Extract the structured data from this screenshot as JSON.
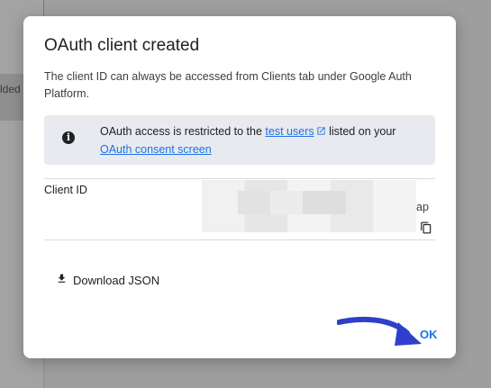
{
  "background": {
    "partial_label": "lded"
  },
  "dialog": {
    "title": "OAuth client created",
    "description": "The client ID can always be accessed from Clients tab under Google Auth Platform.",
    "notice": {
      "prefix": "OAuth access is restricted to the ",
      "link_test_users": "test users",
      "middle": " listed on your ",
      "link_consent_screen": "OAuth consent screen"
    },
    "client_id": {
      "label": "Client ID",
      "value_suffix": "ap"
    },
    "download_label": "Download JSON",
    "ok_label": "OK"
  },
  "colors": {
    "accent": "#1a73e8",
    "annotation_arrow": "#2f3fc9"
  },
  "icons": {
    "info": "info-icon",
    "external_link": "external-link-icon",
    "copy": "copy-icon",
    "download": "download-icon"
  }
}
